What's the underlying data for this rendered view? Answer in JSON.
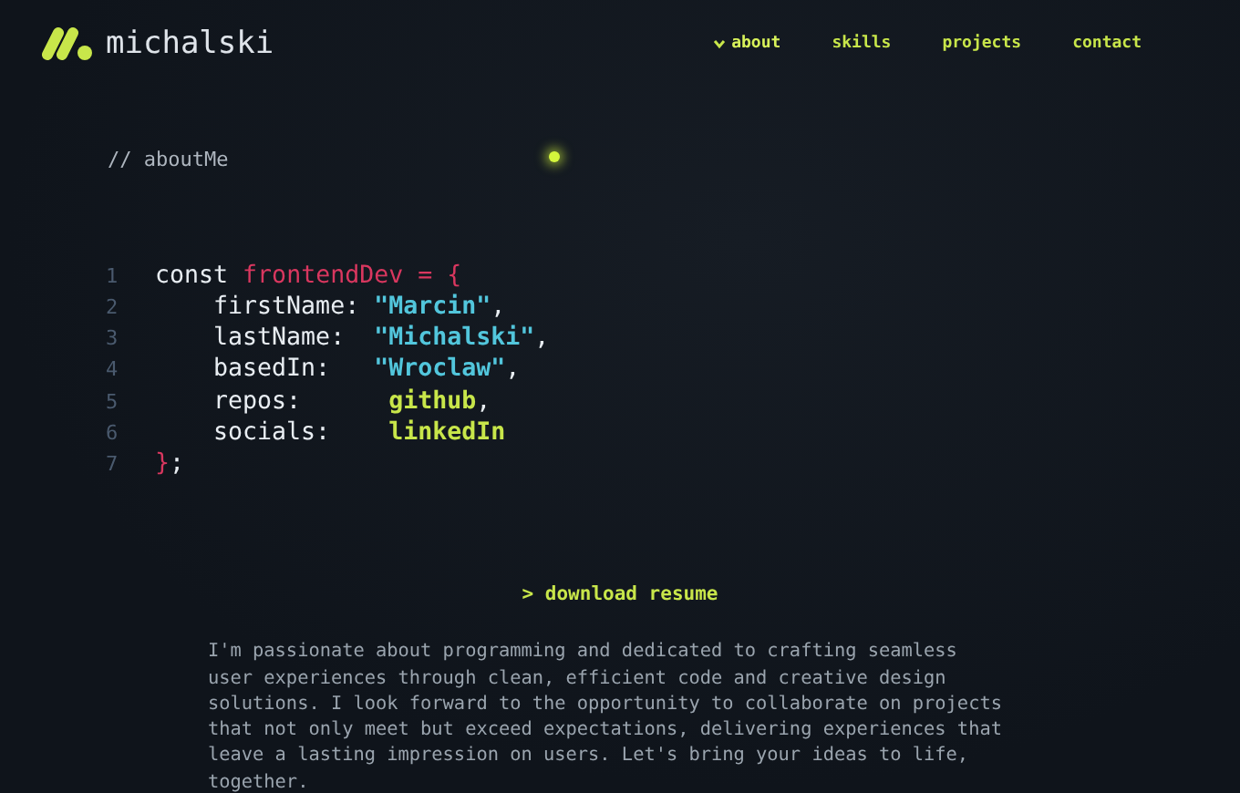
{
  "brand": {
    "name": "michalski"
  },
  "nav": [
    {
      "label": "about",
      "selected": true
    },
    {
      "label": "skills",
      "selected": false
    },
    {
      "label": "projects",
      "selected": false
    },
    {
      "label": "contact",
      "selected": false
    }
  ],
  "section_comment": "// aboutMe",
  "code": [
    {
      "number": "1",
      "tokens": [
        {
          "text": "const ",
          "kind": "keyword"
        },
        {
          "text": "frontendDev",
          "kind": "name"
        },
        {
          "text": " = {",
          "kind": "brace"
        }
      ]
    },
    {
      "number": "2",
      "tokens": [
        {
          "text": "    firstName: ",
          "kind": "key"
        },
        {
          "text": "\"Marcin\"",
          "kind": "string"
        },
        {
          "text": ",",
          "kind": "punct"
        }
      ]
    },
    {
      "number": "3",
      "tokens": [
        {
          "text": "    lastName:  ",
          "kind": "key"
        },
        {
          "text": "\"Michalski\"",
          "kind": "string"
        },
        {
          "text": ",",
          "kind": "punct"
        }
      ]
    },
    {
      "number": "4",
      "tokens": [
        {
          "text": "    basedIn:   ",
          "kind": "key"
        },
        {
          "text": "\"Wroclaw\"",
          "kind": "string"
        },
        {
          "text": ",",
          "kind": "punct"
        }
      ]
    },
    {
      "number": "5",
      "tokens": [
        {
          "text": "    repos:      ",
          "kind": "key"
        },
        {
          "text": "github",
          "kind": "link"
        },
        {
          "text": ",",
          "kind": "punct"
        }
      ]
    },
    {
      "number": "6",
      "tokens": [
        {
          "text": "    socials:    ",
          "kind": "key"
        },
        {
          "text": "linkedIn",
          "kind": "link"
        }
      ]
    },
    {
      "number": "7",
      "tokens": [
        {
          "text": "}",
          "kind": "brace"
        },
        {
          "text": ";",
          "kind": "punct"
        }
      ]
    }
  ],
  "resume_link": "> download resume",
  "bio": "I'm passionate about programming and dedicated to crafting seamless user experiences through clean, efficient code and creative design solutions. I look forward to the opportunity to collaborate on projects that not only meet but exceed expectations, delivering experiences that leave a lasting impression on users. Let's bring your ideas to life, together."
}
